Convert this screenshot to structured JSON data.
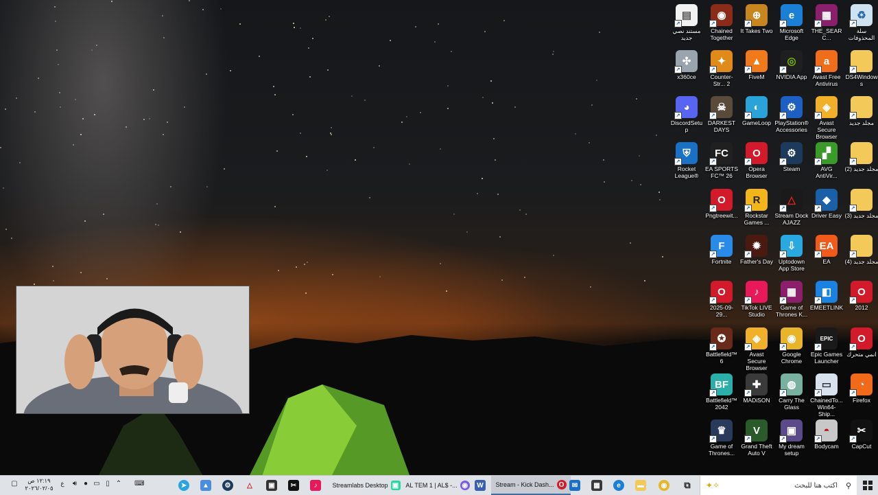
{
  "desktop": {
    "icons": [
      {
        "label": "مستند نصي جديد",
        "name": "text-document-icon",
        "glyph": "▤",
        "color": "#f2f2f2",
        "fg": "#555"
      },
      {
        "label": "Chained Together",
        "name": "chained-together-icon",
        "glyph": "◉",
        "color": "#8b2b1a"
      },
      {
        "label": "It Takes Two",
        "name": "it-takes-two-icon",
        "glyph": "⊕",
        "color": "#c8871e"
      },
      {
        "label": "Microsoft Edge",
        "name": "edge-icon",
        "glyph": "e",
        "color": "#1b7fd6"
      },
      {
        "label": "THE_SEARC...",
        "name": "winrar-archive-icon",
        "glyph": "▦",
        "color": "#8b1f6b"
      },
      {
        "label": "سلة المحذوفات",
        "name": "recycle-bin-icon",
        "glyph": "♻",
        "color": "#cfe2f2",
        "fg": "#2a6aa8"
      },
      {
        "label": "x360ce",
        "name": "gamepad-icon",
        "glyph": "✣",
        "color": "#9aa4ae"
      },
      {
        "label": "Counter-Str... 2",
        "name": "counter-strike-icon",
        "glyph": "✦",
        "color": "#e08a1a"
      },
      {
        "label": "FiveM",
        "name": "fivem-icon",
        "glyph": "▲",
        "color": "#f07a1a"
      },
      {
        "label": "NVIDIA App",
        "name": "nvidia-icon",
        "glyph": "◎",
        "color": "#1f1f1f",
        "fg": "#76b900"
      },
      {
        "label": "Avast Free Antivirus",
        "name": "avast-antivirus-icon",
        "glyph": "a",
        "color": "#f06d1b"
      },
      {
        "label": "DS4Windows",
        "name": "folder-icon",
        "glyph": "",
        "color": "#f3c95a"
      },
      {
        "label": "DiscordSetup",
        "name": "discord-icon",
        "glyph": "◕",
        "color": "#5865f2"
      },
      {
        "label": "DARKEST DAYS",
        "name": "darkest-days-icon",
        "glyph": "☠",
        "color": "#5a4a3a"
      },
      {
        "label": "GameLoop",
        "name": "gameloop-icon",
        "glyph": "◐",
        "color": "#2aa4d8"
      },
      {
        "label": "PlayStation® Accessories",
        "name": "playstation-icon",
        "glyph": "⚙",
        "color": "#1d5fc2"
      },
      {
        "label": "Avast Secure Browser",
        "name": "avast-browser-icon",
        "glyph": "◈",
        "color": "#f0b02a"
      },
      {
        "label": "مجلد جديد",
        "name": "folder-icon",
        "glyph": "",
        "color": "#f3c95a"
      },
      {
        "label": "Rocket League®",
        "name": "rocket-league-icon",
        "glyph": "⛨",
        "color": "#1a70c4"
      },
      {
        "label": "EA SPORTS FC™ 26",
        "name": "ea-fc-icon",
        "glyph": "FC",
        "color": "#202020"
      },
      {
        "label": "Opera Browser",
        "name": "opera-icon",
        "glyph": "O",
        "color": "#d21a2a"
      },
      {
        "label": "Steam",
        "name": "steam-icon",
        "glyph": "⚙",
        "color": "#1b3a5c"
      },
      {
        "label": "AVG AntiVir...",
        "name": "avg-icon",
        "glyph": "▞",
        "color": "#3a9a2a"
      },
      {
        "label": "مجلد جديد (2)",
        "name": "folder-icon",
        "glyph": "",
        "color": "#f3c95a"
      },
      {
        "label": "Pngtreewit...",
        "name": "opera-file-icon",
        "glyph": "O",
        "color": "#d21a2a"
      },
      {
        "label": "Rockstar Games ...",
        "name": "rockstar-icon",
        "glyph": "R",
        "color": "#f2b51a",
        "fg": "#222"
      },
      {
        "label": "Stream Dock AJAZZ",
        "name": "stream-dock-icon",
        "glyph": "△",
        "color": "#1a1a1a",
        "fg": "#d22"
      },
      {
        "label": "Driver Easy",
        "name": "driver-easy-icon",
        "glyph": "◆",
        "color": "#1a5fa8"
      },
      {
        "label": "مجلد جديد (3)",
        "name": "folder-icon",
        "glyph": "",
        "color": "#f3c95a"
      },
      {
        "label": "Fortnite",
        "name": "fortnite-icon",
        "glyph": "F",
        "color": "#2a8ae8"
      },
      {
        "label": "Father's Day",
        "name": "fathers-day-icon",
        "glyph": "✹",
        "color": "#4a1a10"
      },
      {
        "label": "Uptodown App Store",
        "name": "uptodown-icon",
        "glyph": "⇩",
        "color": "#29a9e0"
      },
      {
        "label": "EA",
        "name": "ea-icon",
        "glyph": "EA",
        "color": "#f05a1a"
      },
      {
        "label": "مجلد جديد (4)",
        "name": "folder-icon",
        "glyph": "",
        "color": "#f3c95a"
      },
      {
        "label": "2025-09-29...",
        "name": "opera-file-icon",
        "glyph": "O",
        "color": "#d21a2a"
      },
      {
        "label": "TikTok LIVE Studio",
        "name": "tiktok-icon",
        "glyph": "♪",
        "color": "#e8185a"
      },
      {
        "label": "Game of Thrones K...",
        "name": "winrar-archive-icon",
        "glyph": "▦",
        "color": "#8b1f6b"
      },
      {
        "label": "EMEETLINK",
        "name": "emeetlink-icon",
        "glyph": "◧",
        "color": "#1a82e2"
      },
      {
        "label": "2012",
        "name": "opera-file-icon",
        "glyph": "O",
        "color": "#d21a2a"
      },
      {
        "label": "Battlefield™ 6",
        "name": "battlefield6-icon",
        "glyph": "✪",
        "color": "#6a2a1a"
      },
      {
        "label": "Avast Secure Browser",
        "name": "avast-browser-icon",
        "glyph": "◈",
        "color": "#f0b02a"
      },
      {
        "label": "Google Chrome",
        "name": "chrome-icon",
        "glyph": "◉",
        "color": "#e8b52a"
      },
      {
        "label": "Epic Games Launcher",
        "name": "epic-games-icon",
        "glyph": "EPIC",
        "color": "#1a1a1a"
      },
      {
        "label": "انمي متحرك",
        "name": "opera-file-icon",
        "glyph": "O",
        "color": "#d21a2a"
      },
      {
        "label": "Battlefield™ 2042",
        "name": "battlefield2042-icon",
        "glyph": "BF",
        "color": "#2ab0a8"
      },
      {
        "label": "MADiSON",
        "name": "madison-icon",
        "glyph": "✚",
        "color": "#3a3a3a"
      },
      {
        "label": "Carry The Glass",
        "name": "carry-the-glass-icon",
        "glyph": "◍",
        "color": "#7ab0a0"
      },
      {
        "label": "ChainedTo... Win64-Ship...",
        "name": "chained-exe-icon",
        "glyph": "▭",
        "color": "#d8e2ee",
        "fg": "#334"
      },
      {
        "label": "Firefox",
        "name": "firefox-icon",
        "glyph": "◔",
        "color": "#f06a1a"
      },
      {
        "label": "Game of Thrones...",
        "name": "game-of-thrones-icon",
        "glyph": "♛",
        "color": "#2a3a5a"
      },
      {
        "label": "Grand Theft Auto V",
        "name": "gta5-icon",
        "glyph": "V",
        "color": "#2a5a2a"
      },
      {
        "label": "My dream setup",
        "name": "dream-setup-icon",
        "glyph": "▣",
        "color": "#5a4a8a"
      },
      {
        "label": "Bodycam",
        "name": "bodycam-icon",
        "glyph": "◓",
        "color": "#c8c8c8",
        "fg": "#b11"
      },
      {
        "label": "CapCut",
        "name": "capcut-icon",
        "glyph": "✂",
        "color": "#111111"
      }
    ]
  },
  "taskbar": {
    "search_placeholder": "اكتب هنا للبحث",
    "clock_time": "١٢:١٩ ص",
    "clock_date": "٢٠٢٦/٠٢/٠٥",
    "language": "ع",
    "apps": [
      {
        "label": "Streamlabs Desktop",
        "name": "taskbar-streamlabs"
      },
      {
        "label": "AL TEM 1 | AL$ -...",
        "name": "taskbar-stream-chat"
      },
      {
        "label": "Stream - Kick Dash...",
        "name": "taskbar-kick-dashboard"
      }
    ]
  }
}
